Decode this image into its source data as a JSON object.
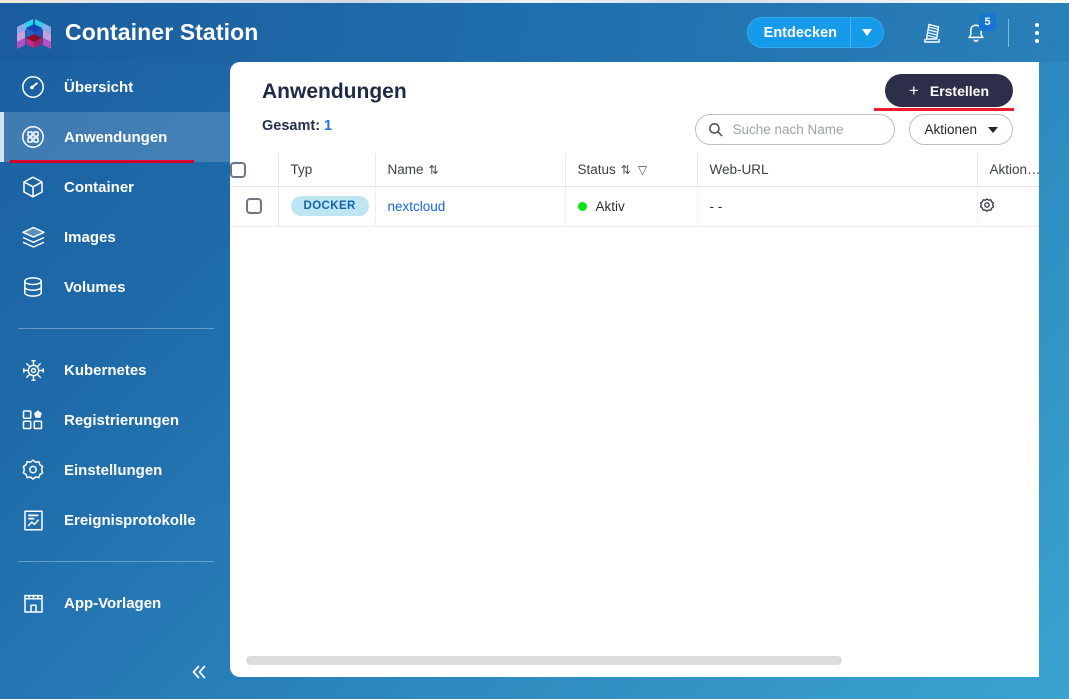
{
  "app": {
    "title": "Container Station",
    "logo_icon": "container-station-cube-logo"
  },
  "header": {
    "discover_label": "Entdecken",
    "discover_caret_icon": "chevron-down-icon",
    "release_notes_icon": "release-notes-icon",
    "notifications_icon": "bell-icon",
    "notifications_count": "5",
    "overflow_icon": "kebab-menu-icon",
    "accent_color": "#169bea",
    "background_color": "#1f6cab"
  },
  "sidebar": {
    "collapse_icon": "chevrons-left-icon",
    "active_index": 1,
    "items": [
      {
        "label": "Übersicht",
        "icon": "gauge-icon"
      },
      {
        "label": "Anwendungen",
        "icon": "grid-apps-icon"
      },
      {
        "label": "Container",
        "icon": "cube-icon"
      },
      {
        "label": "Images",
        "icon": "layers-icon"
      },
      {
        "label": "Volumes",
        "icon": "database-icon"
      },
      {
        "label": "Kubernetes",
        "icon": "kubernetes-helm-icon"
      },
      {
        "label": "Registrierungen",
        "icon": "registry-grid-icon"
      },
      {
        "label": "Einstellungen",
        "icon": "gear-icon"
      },
      {
        "label": "Ereignisprotokolle",
        "icon": "event-log-icon"
      },
      {
        "label": "App-Vorlagen",
        "icon": "storefront-icon"
      }
    ],
    "active_underline_color": "#d6002a"
  },
  "main": {
    "page_title": "Anwendungen",
    "total_label": "Gesamt:",
    "total_value": "1",
    "create_button": {
      "label": "Erstellen",
      "plus_icon": "plus-icon",
      "background_color": "#2d2f4a",
      "highlight_color": "#ee1b2e"
    },
    "search": {
      "placeholder": "Suche nach Name",
      "value": "",
      "icon": "search-icon"
    },
    "actions_button": {
      "label": "Aktionen",
      "caret_icon": "chevron-down-icon"
    },
    "table": {
      "select_all_checkbox": "unchecked",
      "columns": [
        {
          "key": "typ",
          "label": "Typ",
          "sortable": false,
          "filterable": false
        },
        {
          "key": "name",
          "label": "Name",
          "sortable": true,
          "filterable": false,
          "sort_icon": "⇅"
        },
        {
          "key": "status",
          "label": "Status",
          "sortable": true,
          "filterable": true,
          "sort_icon": "⇅",
          "filter_icon": "▽"
        },
        {
          "key": "url",
          "label": "Web-URL",
          "sortable": false,
          "filterable": false
        },
        {
          "key": "act",
          "label": "Aktion…",
          "sortable": false,
          "filterable": false
        }
      ],
      "rows": [
        {
          "checkbox": "unchecked",
          "typ": "DOCKER",
          "name": "nextcloud",
          "status": "Aktiv",
          "status_color": "#0ce60c",
          "url": "- -",
          "action_icon": "gear-icon"
        }
      ]
    },
    "scrollbar": "horizontal-scrollbar"
  }
}
